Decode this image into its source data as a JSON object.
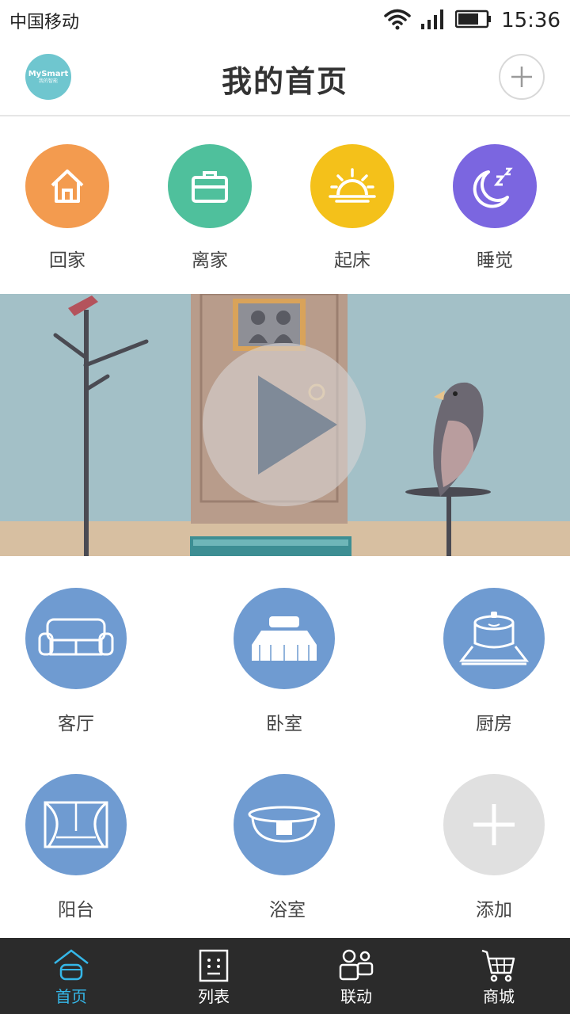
{
  "status_bar": {
    "carrier": "中国移动",
    "time": "15:36",
    "icons": [
      "wifi-icon",
      "signal-icon",
      "battery-icon"
    ]
  },
  "header": {
    "logo_text": "MySmart",
    "logo_subtext": "我的智能",
    "title": "我的首页",
    "add_icon": "plus-icon"
  },
  "scenes": [
    {
      "label": "回家",
      "icon": "home-icon",
      "color": "#f39b4f"
    },
    {
      "label": "离家",
      "icon": "briefcase-icon",
      "color": "#4fc09c"
    },
    {
      "label": "起床",
      "icon": "sunrise-icon",
      "color": "#f4c11a"
    },
    {
      "label": "睡觉",
      "icon": "moon-icon",
      "color": "#7b66e0"
    }
  ],
  "banner": {
    "play_icon": "play-icon"
  },
  "rooms": [
    {
      "label": "客厅",
      "icon": "sofa-icon"
    },
    {
      "label": "卧室",
      "icon": "bed-icon"
    },
    {
      "label": "厨房",
      "icon": "rice-cooker-icon"
    },
    {
      "label": "阳台",
      "icon": "curtain-icon"
    },
    {
      "label": "浴室",
      "icon": "bathtub-icon"
    },
    {
      "label": "添加",
      "icon": "plus-icon"
    }
  ],
  "room_color": "#6f9bd1",
  "add_room_color": "#e0e0e0",
  "tabbar": {
    "tabs": [
      {
        "label": "首页",
        "icon": "home-tab-icon",
        "active": true
      },
      {
        "label": "列表",
        "icon": "list-tab-icon",
        "active": false
      },
      {
        "label": "联动",
        "icon": "link-tab-icon",
        "active": false
      },
      {
        "label": "商城",
        "icon": "cart-tab-icon",
        "active": false
      }
    ],
    "active_color": "#35b7e8"
  }
}
